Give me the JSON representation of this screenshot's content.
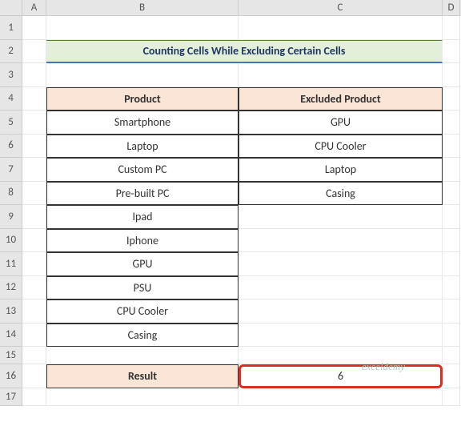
{
  "columns": [
    "A",
    "B",
    "C",
    "D"
  ],
  "rows": [
    "1",
    "2",
    "3",
    "4",
    "5",
    "6",
    "7",
    "8",
    "9",
    "10",
    "11",
    "12",
    "13",
    "14",
    "15",
    "16",
    "17"
  ],
  "title": "Counting Cells While Excluding Certain Cells",
  "headers": {
    "product": "Product",
    "excluded": "Excluded Product",
    "result": "Result"
  },
  "products": [
    "Smartphone",
    "Laptop",
    "Custom PC",
    "Pre-built PC",
    "Ipad",
    "Iphone",
    "GPU",
    "PSU",
    "CPU Cooler",
    "Casing"
  ],
  "excluded": [
    "GPU",
    "CPU Cooler",
    "Laptop",
    "Casing"
  ],
  "result_value": "6",
  "watermark": "exceldemy",
  "chart_data": {
    "type": "table",
    "title": "Counting Cells While Excluding Certain Cells",
    "columns": [
      "Product",
      "Excluded Product"
    ],
    "data": [
      [
        "Smartphone",
        "GPU"
      ],
      [
        "Laptop",
        "CPU Cooler"
      ],
      [
        "Custom PC",
        "Laptop"
      ],
      [
        "Pre-built PC",
        "Casing"
      ],
      [
        "Ipad",
        ""
      ],
      [
        "Iphone",
        ""
      ],
      [
        "GPU",
        ""
      ],
      [
        "PSU",
        ""
      ],
      [
        "CPU Cooler",
        ""
      ],
      [
        "Casing",
        ""
      ]
    ],
    "result": 6
  }
}
